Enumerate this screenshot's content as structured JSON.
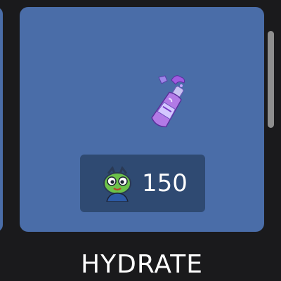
{
  "item": {
    "title": "HYDRATE",
    "price": "150",
    "art_icon": "purple-drink-bottle-icon",
    "currency_icon": "green-alien-robot-avatar-icon"
  },
  "colors": {
    "background": "#1a1a1c",
    "card": "#4a6da8",
    "price_box": "#2f4a72",
    "text": "#ffffff",
    "scrollbar": "#8e8e8e"
  }
}
